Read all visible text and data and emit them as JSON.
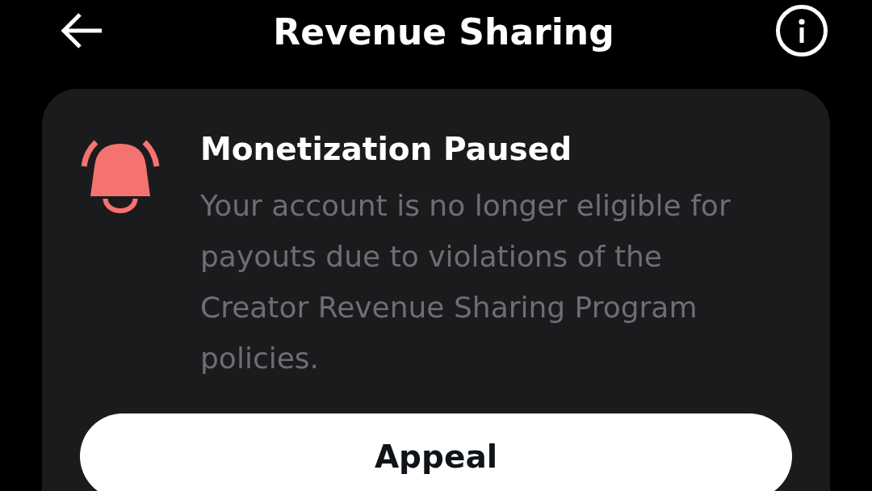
{
  "header": {
    "title": "Revenue Sharing"
  },
  "notice": {
    "title": "Monetization Paused",
    "message": "Your account is no longer eligible for payouts due to violations of the Creator Revenue Sharing Program policies.",
    "action": "Appeal"
  }
}
